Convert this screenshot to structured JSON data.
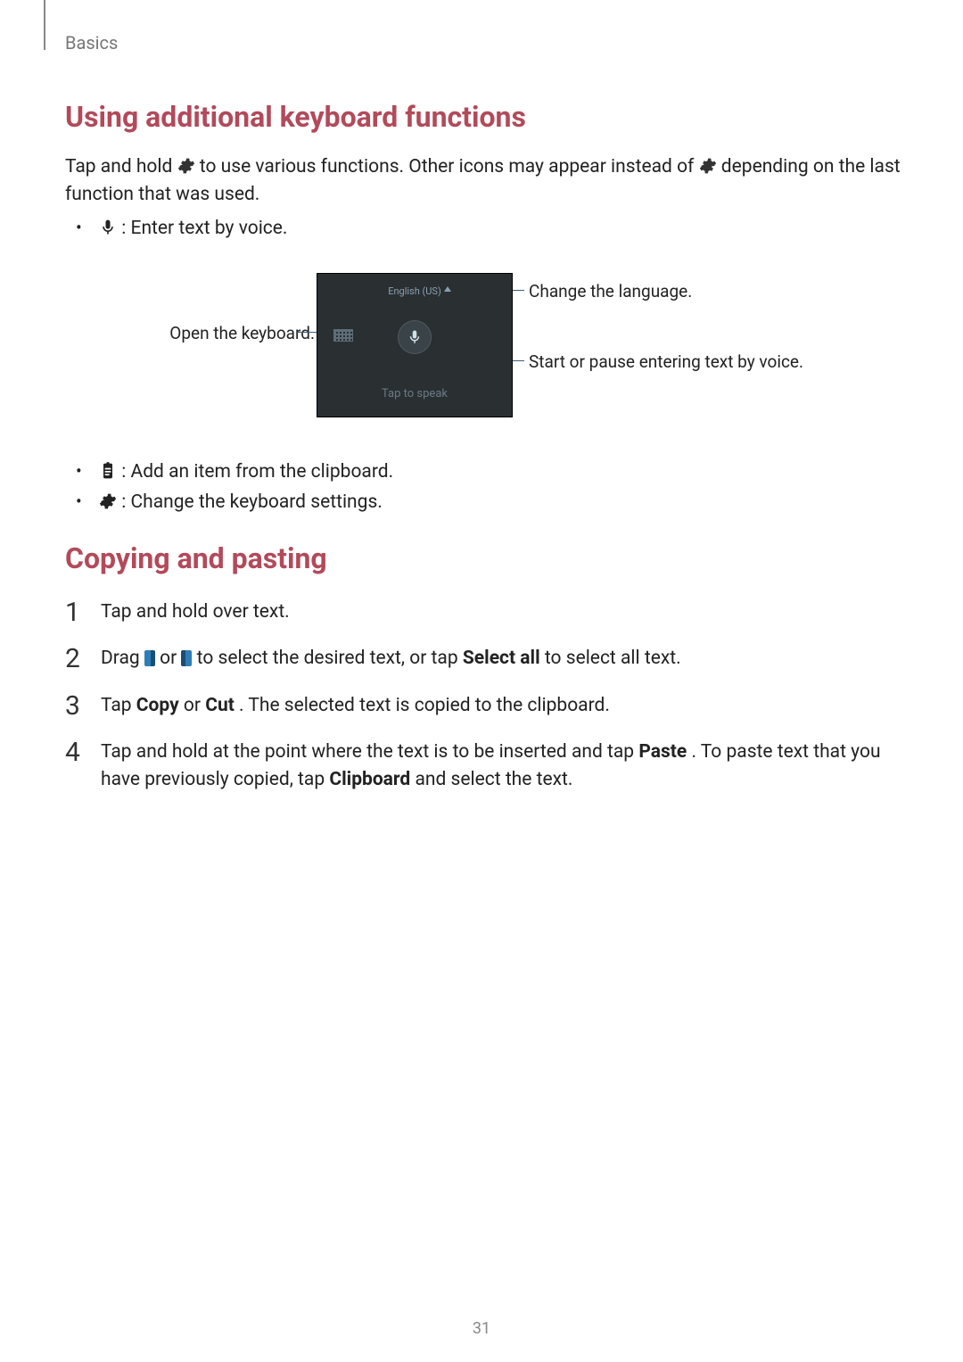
{
  "section": "Basics",
  "page_number": "31",
  "heading1": "Using additional keyboard functions",
  "intro_a": "Tap and hold ",
  "intro_b": " to use various functions. Other icons may appear instead of ",
  "intro_c": " depending on the last function that was used.",
  "bullets1": {
    "voice": " : Enter text by voice.",
    "clipboard": " : Add an item from the clipboard.",
    "settings": " : Change the keyboard settings."
  },
  "figure": {
    "left_label": "Open the keyboard.",
    "right_label_lang": "Change the language.",
    "right_label_voice": "Start or pause entering text by voice.",
    "tap_to_speak": "Tap to speak",
    "lang_text": "English (US)"
  },
  "heading2": "Copying and pasting",
  "steps": {
    "s1": "Tap and hold over text.",
    "s2_a": "Drag ",
    "s2_b": " or ",
    "s2_c": " to select the desired text, or tap ",
    "s2_bold1": "Select all",
    "s2_d": " to select all text.",
    "s3_a": "Tap ",
    "s3_bold1": "Copy",
    "s3_b": " or ",
    "s3_bold2": "Cut",
    "s3_c": ". The selected text is copied to the clipboard.",
    "s4_a": "Tap and hold at the point where the text is to be inserted and tap ",
    "s4_bold1": "Paste",
    "s4_b": ". To paste text that you have previously copied, tap ",
    "s4_bold2": "Clipboard",
    "s4_c": " and select the text."
  }
}
